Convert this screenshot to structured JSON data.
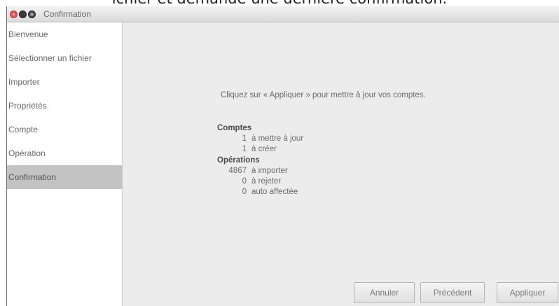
{
  "caption": "ichier et demande une dernière confirmation.",
  "window": {
    "title": "Confirmation"
  },
  "sidebar": {
    "items": [
      {
        "label": "Bienvenue"
      },
      {
        "label": "Sélectionner un fichier"
      },
      {
        "label": "Importer"
      },
      {
        "label": "Propriétés"
      },
      {
        "label": "Compte"
      },
      {
        "label": "Opération"
      },
      {
        "label": "Confirmation",
        "selected": true
      }
    ]
  },
  "main": {
    "intro": "Cliquez sur « Appliquer » pour mettre à jour vos comptes.",
    "accounts": {
      "heading": "Comptes",
      "rows": [
        {
          "count": "1",
          "label": "à mettre à jour"
        },
        {
          "count": "1",
          "label": "à créer"
        }
      ]
    },
    "operations": {
      "heading": "Opérations",
      "rows": [
        {
          "count": "4867",
          "label": "à importer"
        },
        {
          "count": "0",
          "label": "à rejeter"
        },
        {
          "count": "0",
          "label": "auto affectée"
        }
      ]
    }
  },
  "buttons": {
    "cancel": "Annuler",
    "previous": "Précédent",
    "apply": "Appliquer"
  },
  "colors": {
    "window_bg": "#ececec",
    "sidebar_bg": "#ffffff",
    "selected_bg": "#c3c3c3",
    "close_button": "#e0565a"
  }
}
